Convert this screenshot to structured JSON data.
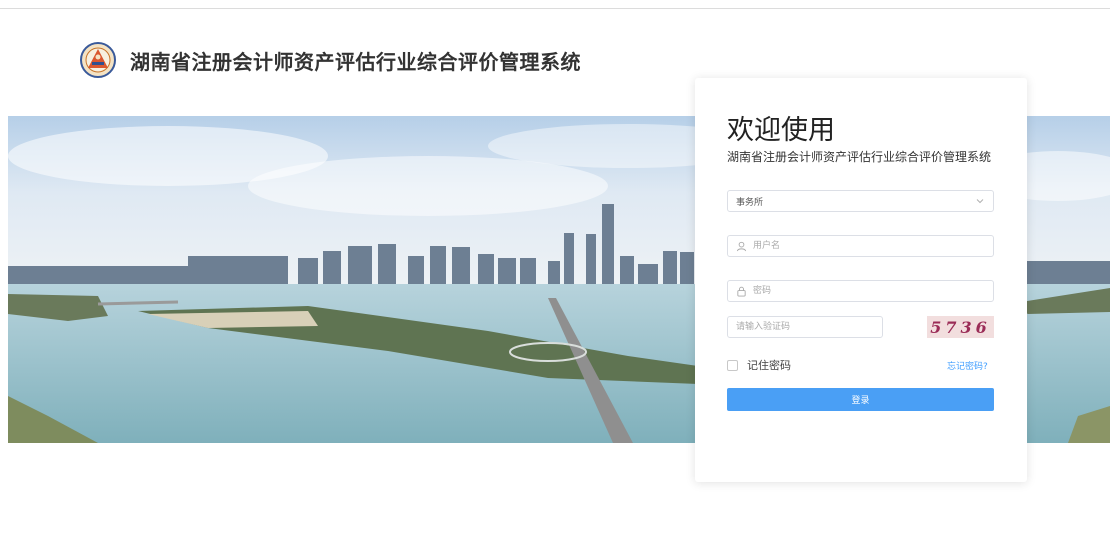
{
  "header": {
    "logo_icon": "association-emblem-icon",
    "title": "湖南省注册会计师资产评估行业综合评价管理系统"
  },
  "login": {
    "welcome": "欢迎使用",
    "subtitle": "湖南省注册会计师资产评估行业综合评价管理系统",
    "org_type_value": "事务所",
    "username_placeholder": "用户名",
    "password_placeholder": "密码",
    "captcha_placeholder": "请输入验证码",
    "captcha_text": "5736",
    "remember_label": "记住密码",
    "forgot_link": "忘记密码?",
    "submit_label": "登录"
  },
  "colors": {
    "accent": "#4a9ff5",
    "link": "#409eff",
    "captcha_bg": "#f2dede"
  }
}
